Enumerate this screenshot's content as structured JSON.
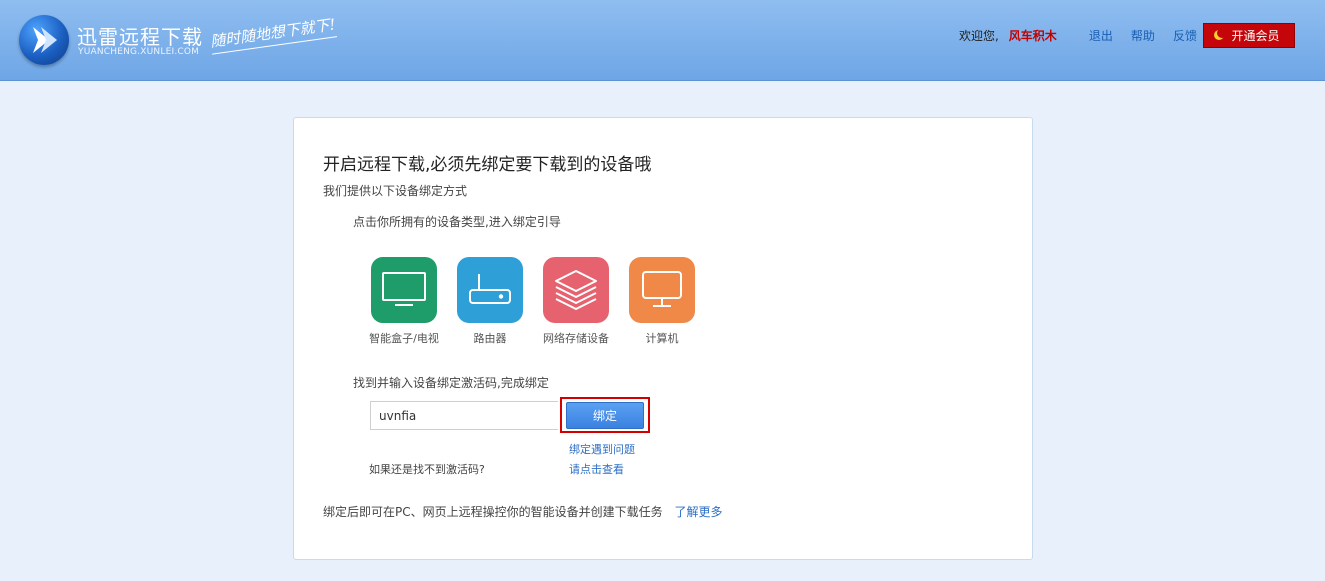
{
  "header": {
    "logo_title": "迅雷远程下载",
    "logo_sub": "YUANCHENG.XUNLEI.COM",
    "slogan": "随时随地想下就下!",
    "welcome": "欢迎您,",
    "username": "风车积木",
    "links": {
      "logout": "退出",
      "help": "帮助",
      "feedback": "反馈"
    },
    "vip_button": "开通会员"
  },
  "card": {
    "title": "开启远程下载,必须先绑定要下载到的设备哦",
    "subtitle": "我们提供以下设备绑定方式",
    "step1": "点击你所拥有的设备类型,进入绑定引导",
    "devices": [
      {
        "label": "智能盒子/电视",
        "color": "#1e9d6b",
        "icon": "tv-icon"
      },
      {
        "label": "路由器",
        "color": "#2f9fd8",
        "icon": "router-icon"
      },
      {
        "label": "网络存储设备",
        "color": "#e6626e",
        "icon": "storage-stack-icon"
      },
      {
        "label": "计算机",
        "color": "#f08847",
        "icon": "monitor-icon"
      }
    ],
    "step2": "找到并输入设备绑定激活码,完成绑定",
    "code_value": "uvnfia",
    "bind_button": "绑定",
    "help_question": "如果还是找不到激活码?",
    "help_link1": "绑定遇到问题",
    "help_link2": "请点击查看",
    "footer_note": "绑定后即可在PC、网页上远程操控你的智能设备并创建下载任务",
    "learn_more": "了解更多"
  }
}
